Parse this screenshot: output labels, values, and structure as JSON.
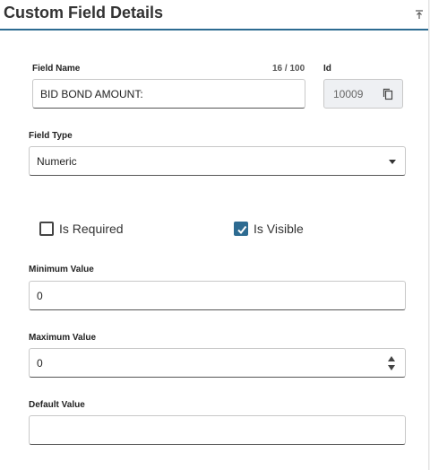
{
  "header": {
    "title": "Custom Field Details",
    "collapse_icon": "collapse-up-icon"
  },
  "field_name": {
    "label": "Field Name",
    "counter": "16 / 100",
    "value": "BID BOND AMOUNT:"
  },
  "id_field": {
    "label": "Id",
    "value": "10009",
    "copy_icon": "copy-icon"
  },
  "field_type": {
    "label": "Field Type",
    "selected": "Numeric"
  },
  "checkboxes": {
    "is_required": {
      "label": "Is Required",
      "checked": false
    },
    "is_visible": {
      "label": "Is Visible",
      "checked": true
    }
  },
  "minimum_value": {
    "label": "Minimum Value",
    "value": "0"
  },
  "maximum_value": {
    "label": "Maximum Value",
    "value": "0"
  },
  "default_value": {
    "label": "Default Value",
    "value": ""
  },
  "colors": {
    "accent": "#2d6b91"
  }
}
